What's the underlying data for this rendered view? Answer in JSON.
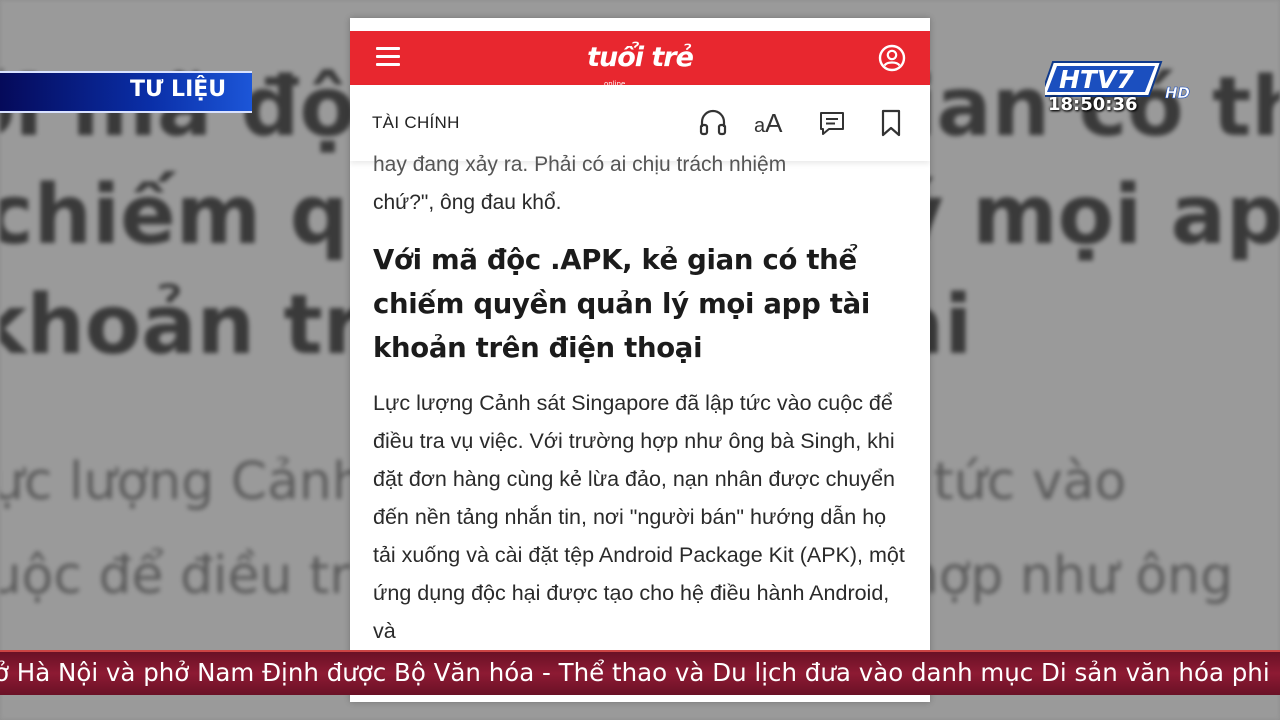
{
  "tv": {
    "segment_label": "TƯ LIỆU",
    "channel": "HTV7",
    "channel_suffix": "HD",
    "clock": "18:50:36",
    "ticker": "ở Hà Nội và phở Nam Định được Bộ Văn hóa - Thể thao và Du lịch đưa vào danh mục Di sản văn hóa phi"
  },
  "app": {
    "logo": "tuổi trẻ",
    "logo_sub": "online",
    "section": "TÀI CHÍNH",
    "text_size_label_small": "a",
    "text_size_label_large": "A",
    "accent_color": "#e8272f",
    "icons": [
      "menu-icon",
      "account-icon",
      "headphones-icon",
      "text-size-icon",
      "comment-icon",
      "bookmark-icon"
    ]
  },
  "article": {
    "prev_line_1": "hay đang xảy ra. Phải có ai chịu trách nhiệm",
    "prev_line_2": "chứ?\", ông đau khổ.",
    "headline": "Với mã độc .APK, kẻ gian có thể chiếm quyền quản lý mọi app tài khoản trên điện thoại",
    "body": "Lực lượng Cảnh sát Singapore đã lập tức vào cuộc để điều tra vụ việc. Với trường hợp như ông bà Singh, khi đặt đơn hàng cùng kẻ lừa đảo, nạn nhân được chuyển đến nền tảng nhắn tin, nơi \"người bán\" hướng dẫn họ tải xuống và cài đặt tệp Android Package Kit (APK), một ứng dụng độc hại được tạo cho hệ điều hành Android, và"
  },
  "backdrop": {
    "line_1": "Với mã độc .APK, kẻ gian có thể",
    "line_2": "chiếm quyền quản lý mọi app tài",
    "line_3": "khoản trên điện thoại",
    "line_4": "Lực lượng Cảnh sát Singapore đã lập tức vào",
    "line_5": "cuộc để điều tra vụ việc. Với trường hợp như ông"
  }
}
